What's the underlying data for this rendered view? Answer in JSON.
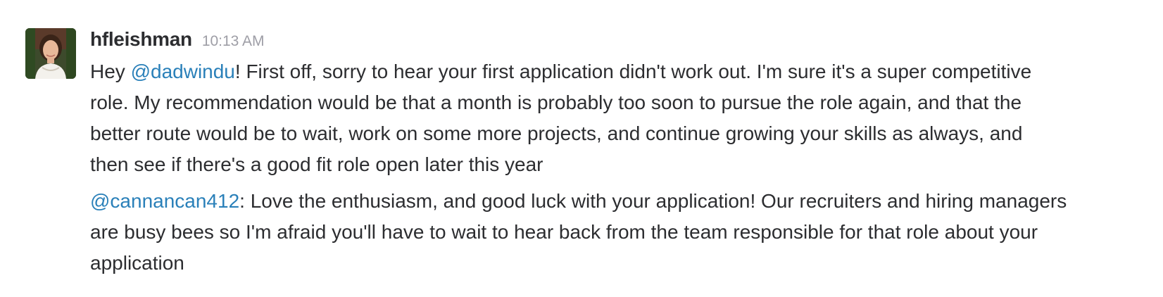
{
  "message": {
    "username": "hfleishman",
    "timestamp": "10:13 AM",
    "avatar_icon": "user-photo-avatar",
    "mention_color": "#2a80b9",
    "paragraphs": [
      {
        "mention": "@dadwindu",
        "prefix": "Hey ",
        "suffix": "! First off, sorry to hear your first application didn't work out. I'm sure it's a super competitive",
        "lines": [
          "role. My recommendation would be that a month is probably too soon to pursue the role again, and that the",
          "better route would be to wait, work on some more projects, and continue growing your skills as always, and",
          "then see if there's a good fit role open later this year"
        ]
      },
      {
        "mention": "@cannancan412",
        "prefix": "",
        "suffix": ": Love the enthusiasm, and good luck with your application! Our recruiters and hiring managers",
        "lines": [
          "are busy bees so I'm afraid you'll have to wait to hear back from the team responsible for that role about your",
          "application"
        ]
      }
    ]
  }
}
